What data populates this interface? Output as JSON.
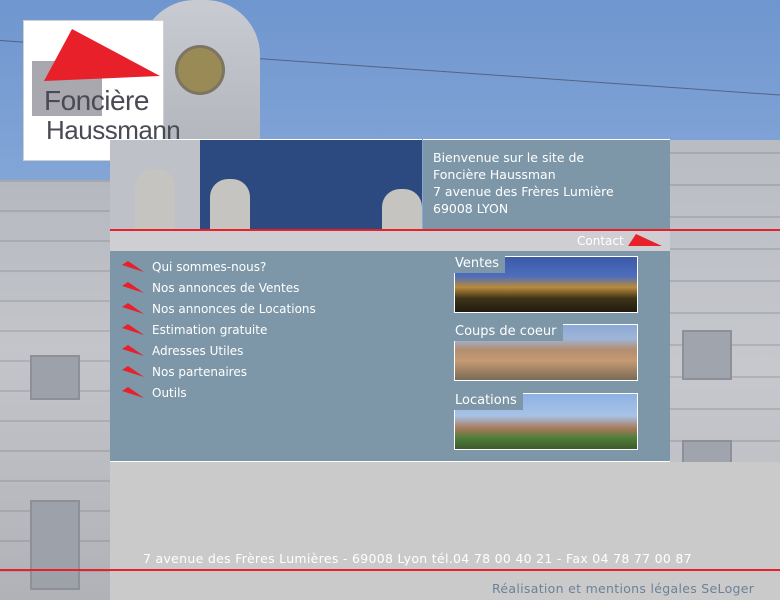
{
  "logo": {
    "line1": "Foncière",
    "line2": "Haussmann",
    "accent_color": "#e8202a"
  },
  "welcome": {
    "lines": [
      "Bienvenue sur le site de",
      "Foncière Haussman",
      "7 avenue des Frères Lumière",
      "69008 LYON"
    ]
  },
  "contact": {
    "label": "Contact"
  },
  "menu": {
    "items": [
      {
        "label": "Qui sommes-nous?"
      },
      {
        "label": "Nos annonces de Ventes"
      },
      {
        "label": "Nos annonces de Locations"
      },
      {
        "label": "Estimation gratuite"
      },
      {
        "label": "Adresses Utiles"
      },
      {
        "label": "Nos partenaires"
      },
      {
        "label": "Outils"
      }
    ],
    "bullet_icon": "red-arrow-icon"
  },
  "categories": [
    {
      "label": "Ventes"
    },
    {
      "label": "Coups de coeur"
    },
    {
      "label": "Locations"
    }
  ],
  "footer": {
    "address": "7 avenue des Frères Lumières - 69008 Lyon  tél.04 78 00 40 21  - Fax 04 78 77 00 87",
    "credit": "Réalisation et mentions légales SeLoger"
  },
  "colors": {
    "panel": "#7d97a8",
    "red": "#e8202a",
    "footer_bg": "#cacaca"
  }
}
